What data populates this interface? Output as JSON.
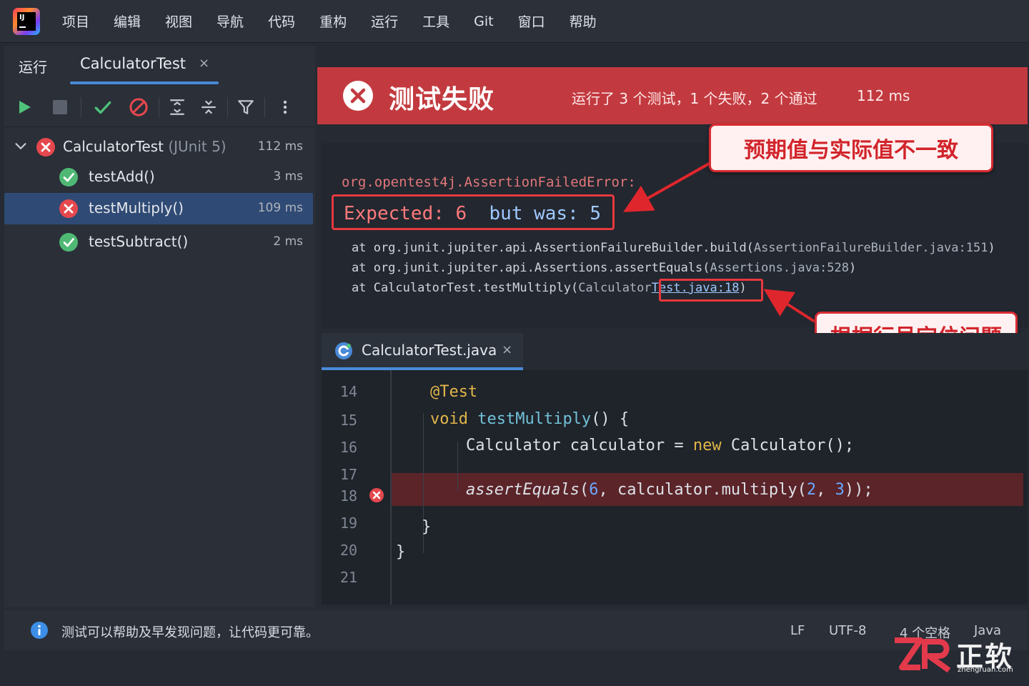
{
  "menubar": {
    "items": [
      "项目",
      "编辑",
      "视图",
      "导航",
      "代码",
      "重构",
      "运行",
      "工具",
      "Git",
      "窗口",
      "帮助"
    ]
  },
  "run_panel": {
    "run_tab_label": "运行",
    "active_tab_label": "CalculatorTest",
    "close_glyph": "×",
    "toolbar_icons": [
      "play-icon",
      "stop-icon",
      "check-icon",
      "ban-icon",
      "expand-all-icon",
      "collapse-all-icon",
      "filter-icon",
      "more-icon"
    ]
  },
  "test_tree": {
    "root": {
      "name": "CalculatorTest",
      "suffix": "(JUnit 5)",
      "time": "112 ms",
      "status": "failed"
    },
    "tests": [
      {
        "name": "testAdd()",
        "time": "3 ms",
        "status": "passed"
      },
      {
        "name": "testMultiply()",
        "time": "109 ms",
        "status": "failed"
      },
      {
        "name": "testSubtract()",
        "time": "2 ms",
        "status": "passed"
      }
    ]
  },
  "banner": {
    "title": "测试失败",
    "summary": "运行了 3 个测试，1 个失败，2 个通过",
    "time": "112 ms",
    "color": "#c23a3f"
  },
  "stacktrace": {
    "error_class": "org.opentest4j.AssertionFailedError:",
    "expected_label": "Expected:",
    "expected_value": "6",
    "but_was_label": "but was:",
    "actual_value": "5",
    "lines": [
      {
        "prefix": "at org.junit.jupiter.api.AssertionFailureBuilder.build(",
        "source": "AssertionFailureBuilder.java:151",
        "suffix": ")"
      },
      {
        "prefix": "at org.junit.jupiter.api.Assertions.assertEquals(",
        "source": "Assertions.java:528",
        "suffix": ")"
      },
      {
        "prefix": "at CalculatorTest.testMultiply(",
        "source_pre": "Calculator",
        "source_link": "Test.java:18",
        "suffix": ")"
      }
    ]
  },
  "callouts": {
    "mismatch": "预期值与实际值不一致",
    "locate": "根据行号定位问题"
  },
  "editor": {
    "tab_label": "CalculatorTest.java",
    "close_glyph": "×",
    "line_numbers": [
      "14",
      "15",
      "16",
      "17",
      "18",
      "19",
      "20",
      "21"
    ],
    "code": {
      "l14_annotation": "@Test",
      "l15_kw": "void",
      "l15_fn": "testMultiply",
      "l15_rest": "() {",
      "l16_pre": "Calculator calculator = ",
      "l16_kw": "new",
      "l16_post": " Calculator();",
      "l18_fn": "assertEquals",
      "l18_open": "(",
      "l18_n1": "6",
      "l18_mid": ", calculator.multiply(",
      "l18_n2": "2",
      "l18_comma": ", ",
      "l18_n3": "3",
      "l18_close": "));",
      "l19": "}",
      "l20": "}"
    }
  },
  "statusbar": {
    "message": "测试可以帮助及早发现问题，让代码更可靠。",
    "line_sep": "LF",
    "encoding": "UTF-8",
    "indent": "4 个空格",
    "language": "Java"
  },
  "watermark": {
    "brand": "正软",
    "url": "zhengruan.com"
  }
}
